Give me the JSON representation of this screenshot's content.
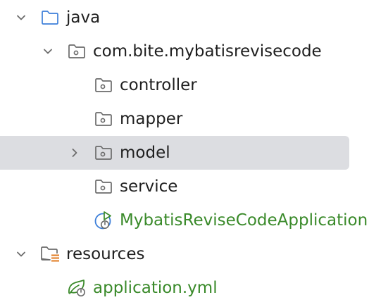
{
  "tree": {
    "nodes": [
      {
        "label": "java",
        "icon": "source-folder-icon",
        "expanded": true
      },
      {
        "label": "com.bite.mybatisrevisecode",
        "icon": "package-icon",
        "expanded": true
      },
      {
        "label": "controller",
        "icon": "package-icon"
      },
      {
        "label": "mapper",
        "icon": "package-icon"
      },
      {
        "label": "model",
        "icon": "package-icon",
        "expanded": false,
        "selected": true
      },
      {
        "label": "service",
        "icon": "package-icon"
      },
      {
        "label": "MybatisReviseCodeApplication",
        "icon": "spring-boot-class-icon"
      },
      {
        "label": "resources",
        "icon": "resources-folder-icon",
        "expanded": true
      },
      {
        "label": "application.yml",
        "icon": "spring-config-icon"
      }
    ]
  },
  "colors": {
    "selection": "#dcdde1",
    "spring_green": "#3a8a2a",
    "folder_blue": "#3d7fd9",
    "resources_orange": "#e07a1f"
  }
}
